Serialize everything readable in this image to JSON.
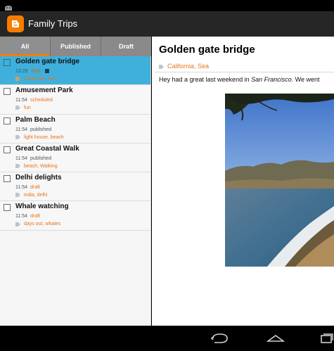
{
  "app": {
    "title": "Family Trips"
  },
  "tabs": [
    {
      "label": "All"
    },
    {
      "label": "Published"
    },
    {
      "label": "Draft"
    }
  ],
  "posts": [
    {
      "title": "Golden gate bridge",
      "time": "13:29",
      "status": "draft",
      "tags": "California, Sea"
    },
    {
      "title": "Amusement Park",
      "time": "11:54",
      "status": "scheduled",
      "tags": "fun"
    },
    {
      "title": "Palm Beach",
      "time": "11:54",
      "status": "published",
      "tags": "light house, beach"
    },
    {
      "title": "Great Coastal Walk",
      "time": "11:54",
      "status": "published",
      "tags": "beach, Walking"
    },
    {
      "title": "Delhi delights",
      "time": "11:54",
      "status": "draft",
      "tags": "india, delhi"
    },
    {
      "title": "Whale watching",
      "time": "11:54",
      "status": "draft",
      "tags": "days out, whales"
    }
  ],
  "detail": {
    "title": "Golden gate bridge",
    "tags": "California, Sea",
    "body_before": "Hey had a great last weekend in ",
    "body_em": "San Francisco",
    "body_after": ". We went"
  },
  "icons": {
    "status_bar": "android-icon",
    "app_logo": "blogger-logo-icon",
    "tag": "tag-icon",
    "note": "note-icon",
    "nav": [
      "back-icon",
      "home-icon",
      "recent-apps-icon"
    ]
  },
  "colors": {
    "accent": "#f57d00",
    "selected_row": "#3fb0dc",
    "tag_text": "#e8741a"
  }
}
